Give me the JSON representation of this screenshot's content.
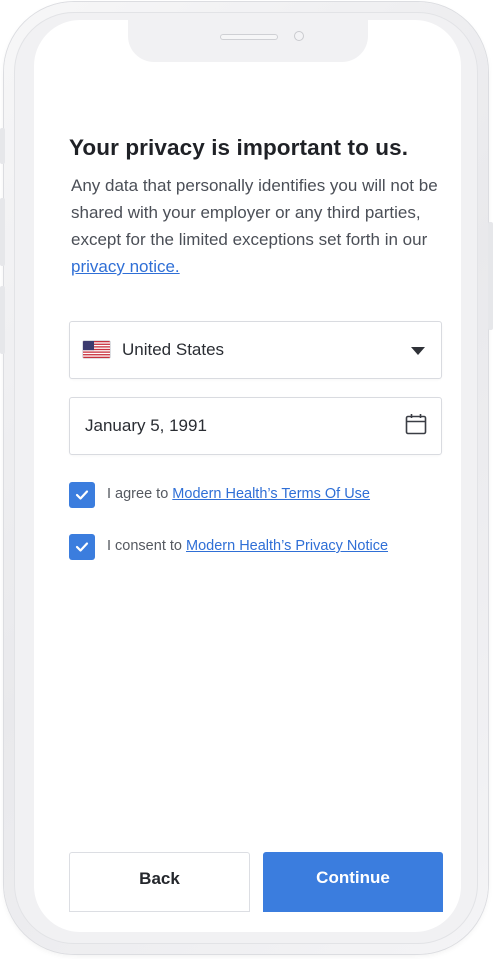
{
  "header": {
    "title": "Your privacy is important to us.",
    "description": "Any data that personally identifies you will not be shared with your employer or any third parties, except for the limited exceptions set forth in our ",
    "privacy_link": "privacy notice."
  },
  "form": {
    "country": {
      "value": "United States",
      "flag_icon": "us-flag-icon"
    },
    "date_of_birth": {
      "value": "January 5, 1991",
      "icon": "calendar-icon"
    }
  },
  "consents": [
    {
      "checked": true,
      "prefix": "I agree to ",
      "link": "Modern Health’s Terms Of Use"
    },
    {
      "checked": true,
      "prefix": "I consent to ",
      "link": "Modern Health’s Privacy Notice"
    }
  ],
  "actions": {
    "back_label": "Back",
    "continue_label": "Continue"
  },
  "colors": {
    "accent": "#3b7dde",
    "link": "#2f6fd6",
    "text": "#1f2126"
  }
}
